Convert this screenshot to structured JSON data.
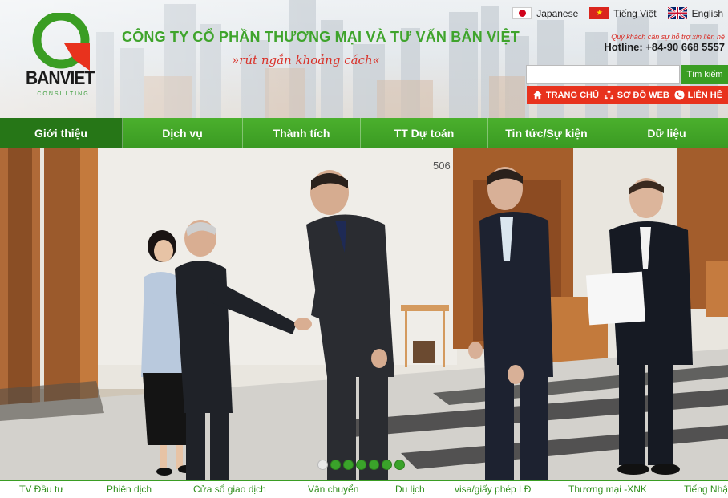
{
  "header": {
    "logo_text": "BANVIET",
    "logo_sub": "CONSULTING",
    "company_name": "CÔNG TY CỔ PHẦN THƯƠNG MẠI VÀ TƯ VẤN BẢN VIỆT",
    "slogan": "rút ngắn khoảng cách",
    "languages": [
      {
        "label": "Japanese",
        "icon": "japan-flag-icon"
      },
      {
        "label": "Tiếng Việt",
        "icon": "vietnam-flag-icon"
      },
      {
        "label": "English",
        "icon": "uk-flag-icon"
      }
    ],
    "support_note": "Quý khách cần sự hỗ trợ xin liên hệ",
    "hotline": "Hotline: +84-90 668 5557",
    "search": {
      "value": "",
      "button_label": "Tìm kiếm"
    },
    "quick_links": [
      {
        "label": "TRANG CHỦ",
        "icon": "home-icon"
      },
      {
        "label": "SƠ ĐỒ WEB",
        "icon": "sitemap-icon"
      },
      {
        "label": "LIÊN HỆ",
        "icon": "phone-icon"
      }
    ]
  },
  "nav": {
    "items": [
      {
        "label": "Giới thiệu",
        "active": true
      },
      {
        "label": "Dịch vụ"
      },
      {
        "label": "Thành tích"
      },
      {
        "label": "TT Dự toán"
      },
      {
        "label": "Tin tức/Sự kiện"
      },
      {
        "label": "Dữ liệu"
      }
    ]
  },
  "hero": {
    "room_number": "506",
    "slide_count": 7,
    "active_slide": 1
  },
  "bottom_links": [
    "TV Đầu tư",
    "Phiên dịch",
    "Cửa sổ giao dịch",
    "Vận chuyển",
    "Du lịch",
    "visa/giấy phép LĐ",
    "Thương mại -XNK",
    "Tiếng Nhật"
  ],
  "colors": {
    "brand_green": "#3a9d23",
    "accent_red": "#e8321d",
    "active_nav": "#267617"
  }
}
